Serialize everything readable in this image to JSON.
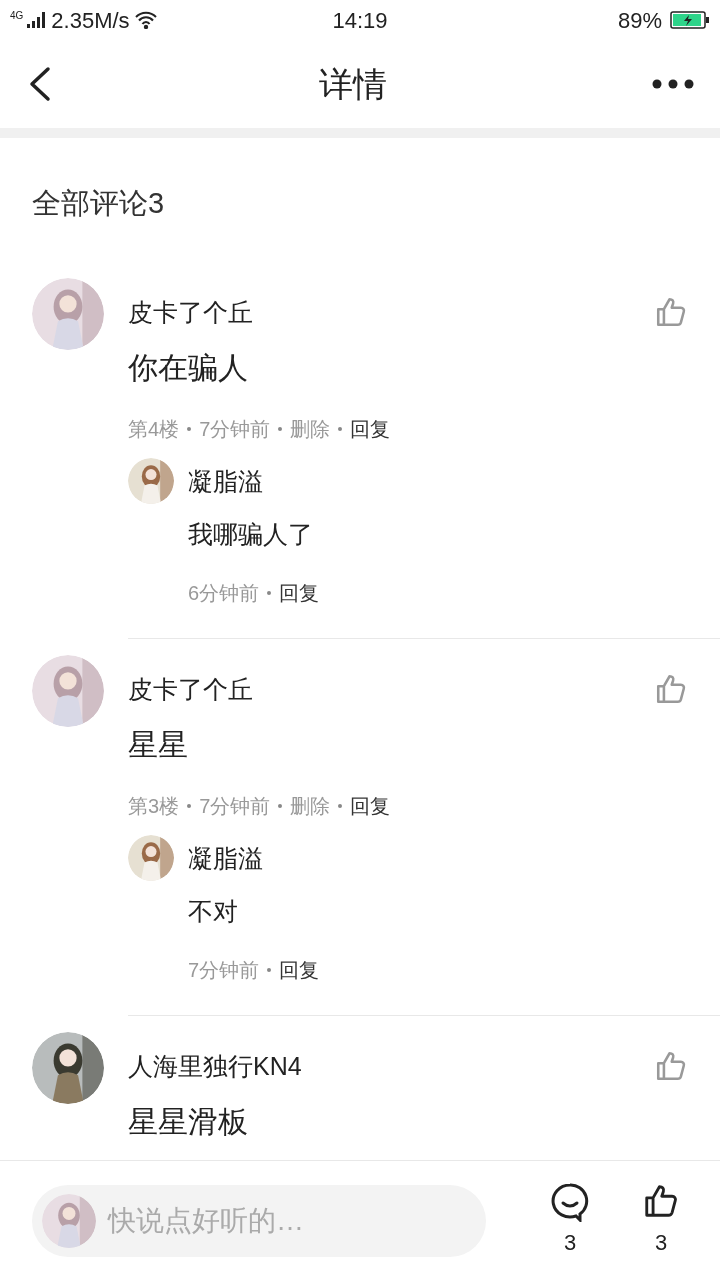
{
  "status_bar": {
    "network": "4G",
    "speed": "2.35M/s",
    "time": "14:19",
    "battery": "89%"
  },
  "header": {
    "title": "详情"
  },
  "comments_heading": "全部评论3",
  "comments": [
    {
      "name": "皮卡了个丘",
      "text": "你在骗人",
      "meta": [
        {
          "text": "第4楼",
          "kind": "info"
        },
        {
          "text": "7分钟前",
          "kind": "info"
        },
        {
          "text": "删除",
          "kind": "info"
        },
        {
          "text": "回复",
          "kind": "action"
        }
      ],
      "replies": [
        {
          "name": "凝脂溢",
          "text": "我哪骗人了",
          "meta": [
            {
              "text": "6分钟前",
              "kind": "info"
            },
            {
              "text": "回复",
              "kind": "action"
            }
          ]
        }
      ]
    },
    {
      "name": "皮卡了个丘",
      "text": "星星",
      "meta": [
        {
          "text": "第3楼",
          "kind": "info"
        },
        {
          "text": "7分钟前",
          "kind": "info"
        },
        {
          "text": "删除",
          "kind": "info"
        },
        {
          "text": "回复",
          "kind": "action"
        }
      ],
      "replies": [
        {
          "name": "凝脂溢",
          "text": "不对",
          "meta": [
            {
              "text": "7分钟前",
              "kind": "info"
            },
            {
              "text": "回复",
              "kind": "action"
            }
          ]
        }
      ]
    },
    {
      "name": "人海里独行KN4",
      "text": "星星滑板"
    }
  ],
  "bottom_bar": {
    "placeholder": "快说点好听的…",
    "comment_count": "3",
    "like_count": "3"
  }
}
